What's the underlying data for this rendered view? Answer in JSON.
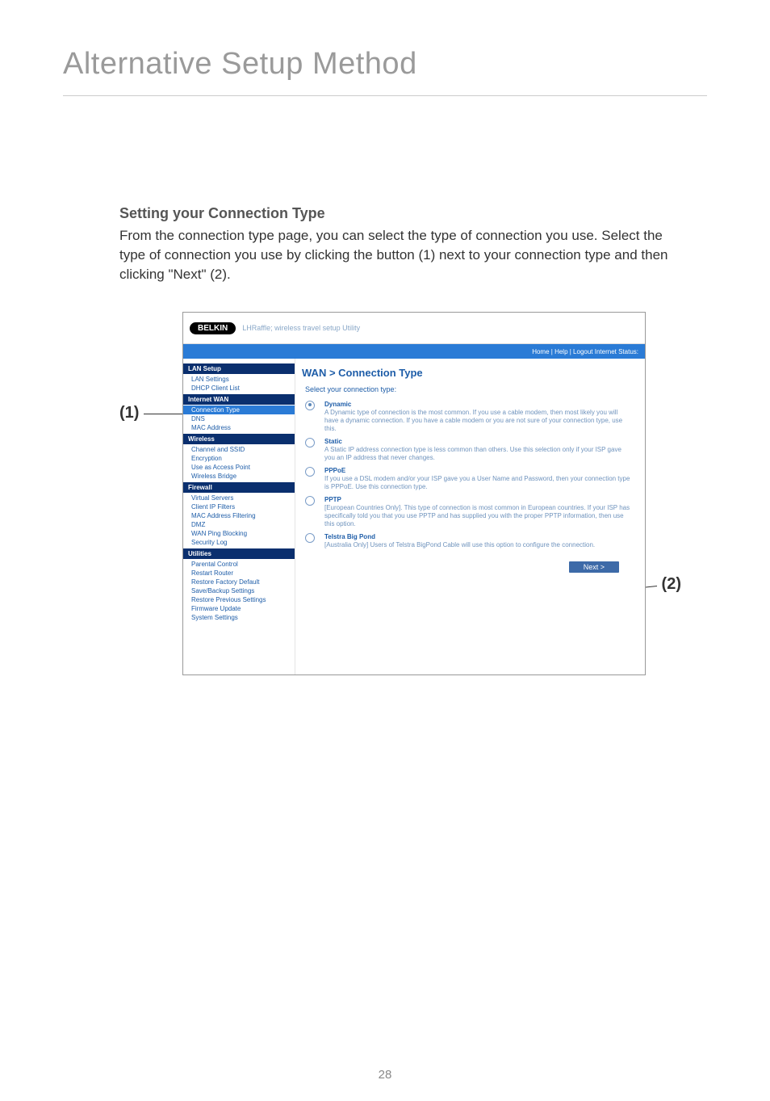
{
  "page": {
    "section_title": "Alternative Setup Method",
    "heading": "Setting your Connection Type",
    "paragraph": "From the connection type page, you can select the type of connection you use. Select the type of connection you use by clicking the button (1) next to your connection type and then clicking \"Next\" (2).",
    "page_number": "28",
    "callout_1": "(1)",
    "callout_2": "(2)"
  },
  "shot": {
    "logo": "BELKIN",
    "product": "LHRaffle; wireless travel setup Utility",
    "bluebar": "Home | Help | Logout   Internet Status:",
    "content_title": "WAN > Connection Type",
    "content_lead": "Select your connection type:",
    "next_label": "Next >",
    "sidebar_groups": [
      {
        "header": "LAN Setup",
        "items": [
          "LAN Settings",
          "DHCP Client List"
        ]
      },
      {
        "header": "Internet WAN",
        "items": [
          "Connection Type",
          "DNS",
          "MAC Address"
        ]
      },
      {
        "header": "Wireless",
        "items": [
          "Channel and SSID",
          "Encryption",
          "Use as Access Point",
          "Wireless Bridge"
        ]
      },
      {
        "header": "Firewall",
        "items": [
          "Virtual Servers",
          "Client IP Filters",
          "MAC Address Filtering",
          "DMZ",
          "WAN Ping Blocking",
          "Security Log"
        ]
      },
      {
        "header": "Utilities",
        "items": [
          "Parental Control",
          "Restart Router",
          "Restore Factory Default",
          "Save/Backup Settings",
          "Restore Previous Settings",
          "Firmware Update",
          "System Settings"
        ]
      }
    ],
    "connection_types": [
      {
        "name": "Dynamic",
        "desc": "A Dynamic type of connection is the most common. If you use a cable modem, then most likely you will have a dynamic connection. If you have a cable modem or you are not sure of your connection type, use this.",
        "selected": true
      },
      {
        "name": "Static",
        "desc": "A Static IP address connection type is less common than others. Use this selection only if your ISP gave you an IP address that never changes.",
        "selected": false
      },
      {
        "name": "PPPoE",
        "desc": "If you use a DSL modem and/or your ISP gave you a User Name and Password, then your connection type is PPPoE. Use this connection type.",
        "selected": false
      },
      {
        "name": "PPTP",
        "desc": "[European Countries Only]. This type of connection is most common in European countries. If your ISP has specifically told you that you use PPTP and has supplied you with the proper PPTP information, then use this option.",
        "selected": false
      },
      {
        "name": "Telstra Big Pond",
        "desc": "[Australia Only] Users of Telstra BigPond Cable will use this option to configure the connection.",
        "selected": false
      }
    ]
  }
}
